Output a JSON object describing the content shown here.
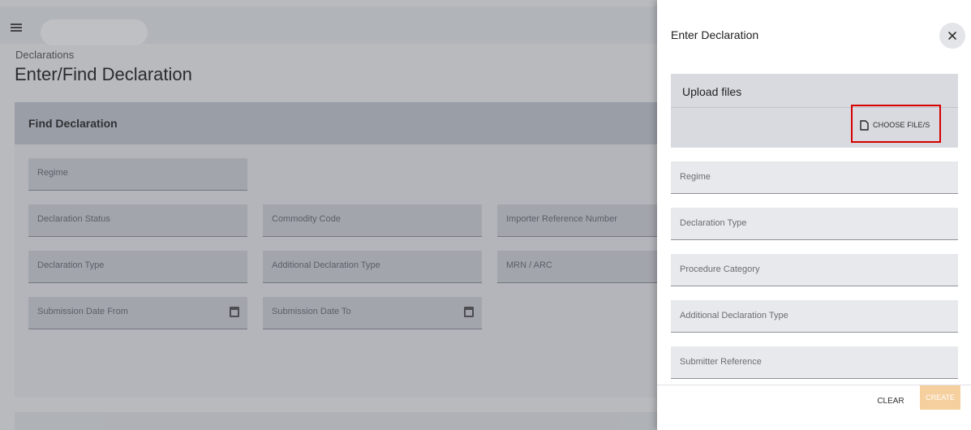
{
  "background": {
    "breadcrumb": "Declarations",
    "title": "Enter/Find Declaration",
    "find_card": {
      "header": "Find Declaration",
      "fields": {
        "regime": "Regime",
        "declaration_status": "Declaration Status",
        "commodity_code": "Commodity Code",
        "importer_reference_number": "Importer Reference Number",
        "declaration_type": "Declaration Type",
        "additional_declaration_type": "Additional Declaration Type",
        "mrn_arc": "MRN / ARC",
        "submission_date_from": "Submission Date From",
        "submission_date_to": "Submission Date To"
      }
    }
  },
  "drawer": {
    "title": "Enter Declaration",
    "upload": {
      "title": "Upload files",
      "choose_label": "CHOOSE FILE/S"
    },
    "fields": {
      "regime": "Regime",
      "declaration_type": "Declaration Type",
      "procedure_category": "Procedure Category",
      "additional_declaration_type": "Additional Declaration Type",
      "submitter_reference": "Submitter Reference"
    },
    "footer": {
      "clear_label": "CLEAR",
      "create_label": "CREATE"
    }
  },
  "colors": {
    "highlight": "#d60000",
    "create_button": "#f6cf9e"
  },
  "icons": {
    "menu": "menu-icon",
    "close": "close-icon",
    "file": "file-icon",
    "calendar": "calendar-icon"
  }
}
